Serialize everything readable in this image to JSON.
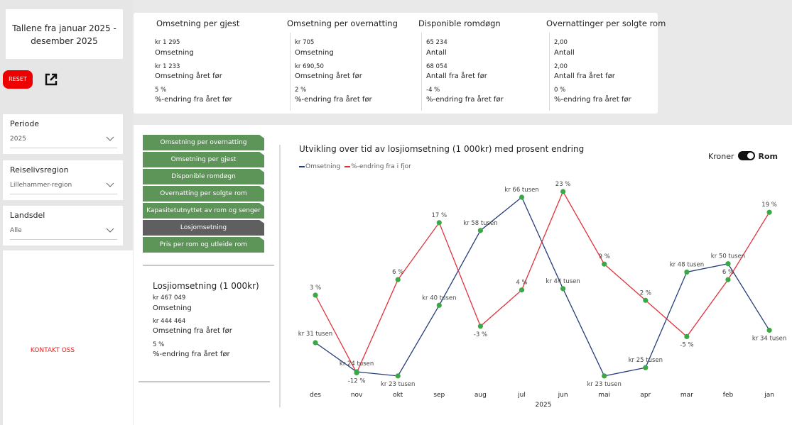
{
  "title_card": "Tallene fra januar 2025 - desember 2025",
  "reset_label": "RESET",
  "filters": [
    {
      "label": "Periode",
      "value": "2025"
    },
    {
      "label": "Reiselivsregion",
      "value": "Lillehammer-region"
    },
    {
      "label": "Landsdel",
      "value": "Alle"
    }
  ],
  "kontakt_label": "KONTAKT OSS",
  "kpis": [
    {
      "title": "Omsetning per gjest",
      "v1": "kr 1 295",
      "d1": "Omsetning",
      "v2": "kr 1 233",
      "d2": "Omsetning året før",
      "v3": "5 %",
      "d3": "%-endring fra året før"
    },
    {
      "title": "Omsetning per overnatting",
      "v1": "kr 705",
      "d1": "Omsetning",
      "v2": "kr 690,50",
      "d2": "Omsetning året før",
      "v3": "2 %",
      "d3": "%-endring fra året før"
    },
    {
      "title": "Disponible romdøgn",
      "v1": "65 234",
      "d1": "Antall",
      "v2": "68 054",
      "d2": "Antall fra året før",
      "v3": "-4 %",
      "d3": "%-endring fra året før"
    },
    {
      "title": "Overnattinger per solgte rom",
      "v1": "2,00",
      "d1": "Antall",
      "v2": "2,00",
      "d2": "Antall fra året før",
      "v3": "0 %",
      "d3": "%-endring fra året før"
    }
  ],
  "nav": [
    {
      "label": "Omsetning per overnatting",
      "active": false
    },
    {
      "label": "Omsetning per gjest",
      "active": false
    },
    {
      "label": "Disponible romdøgn",
      "active": false
    },
    {
      "label": "Overnatting per solgte rom",
      "active": false
    },
    {
      "label": "Kapasitetutnyttet av rom og senger",
      "active": false
    },
    {
      "label": "Losjomsetning",
      "active": true
    },
    {
      "label": "Pris per rom og utleide rom",
      "active": false
    }
  ],
  "losj": {
    "title": "Losjiomsetning (1 000kr)",
    "v1": "kr 467 049",
    "d1": "Omsetning",
    "v2": "kr 444 464",
    "d2": "Omsetning fra året før",
    "v3": "5 %",
    "d3": "%-endring fra året før"
  },
  "toggle": {
    "left": "Kroner",
    "right": "Rom"
  },
  "colors": {
    "omsetning": "#243c78",
    "endring": "#e0323c",
    "marker": "#3aa844",
    "nav": "#5d9457",
    "nav_active": "#5f5f5f",
    "reset": "#ee0000"
  },
  "chart_data": {
    "type": "line",
    "title": "Utvikling over tid av losjiomsetning (1 000kr) med prosent endring",
    "categories": [
      "des",
      "nov",
      "okt",
      "sep",
      "aug",
      "jul",
      "jun",
      "mai",
      "apr",
      "mar",
      "feb",
      "jan"
    ],
    "xlabel": "2025",
    "series": [
      {
        "name": "Omsetning",
        "values": [
          31,
          24,
          23,
          40,
          58,
          66,
          44,
          23,
          25,
          48,
          50,
          34
        ],
        "labels": [
          "kr 31 tusen",
          "kr 24 tusen",
          "kr 23 tusen",
          "kr 40 tusen",
          "kr 58 tusen",
          "kr 66 tusen",
          "kr 44 tusen",
          "kr 23 tusen",
          "kr 25 tusen",
          "kr 48 tusen",
          "kr 50 tusen",
          "kr 34 tusen"
        ]
      },
      {
        "name": "%-endring fra i fjor",
        "values": [
          3,
          -12,
          6,
          17,
          -3,
          4,
          23,
          9,
          2,
          -5,
          6,
          19
        ],
        "labels": [
          "3 %",
          "-12 %",
          "6 %",
          "17 %",
          "-3 %",
          "4 %",
          "23 %",
          "9 %",
          "2 %",
          "-5 %",
          "6 %",
          "19 %"
        ]
      }
    ]
  }
}
